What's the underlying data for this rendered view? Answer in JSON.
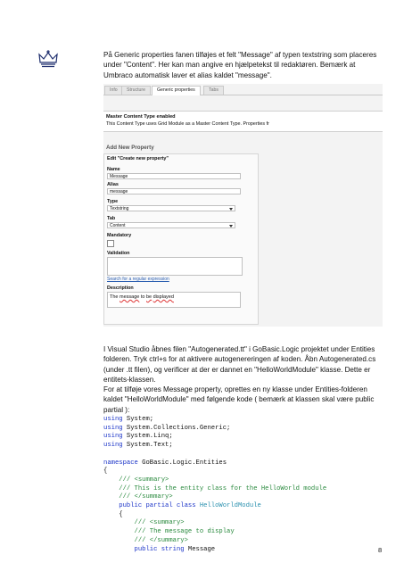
{
  "paragraph1": [
    "På Generic properties fanen tilføjes et felt \"Message\" af typen textstring som placeres",
    "under \"Content\". Her kan man angive en hjælpetekst til redaktøren. Bemærk at",
    "Umbraco automatisk laver et alias kaldet \"message\"."
  ],
  "screenshot": {
    "tabs": [
      "Info",
      "Structure",
      "Generic properties",
      "Tabs"
    ],
    "master_title": "Master Content Type enabled",
    "master_text": "This Content Type uses Grid Module as a Master Content Type. Properties fr",
    "add_new_property": "Add New Property",
    "edit_header": "Edit \"Create new property\"",
    "name_label": "Name",
    "name_value": "Message",
    "alias_label": "Alias",
    "alias_value": "message",
    "type_label": "Type",
    "type_value": "Textstring",
    "tab_label": "Tab",
    "tab_value": "Content",
    "mandatory_label": "Mandatory",
    "validation_label": "Validation",
    "regex_link": "Search for a regular expression",
    "description_label": "Description",
    "description_value": [
      "The ",
      "message",
      " to ",
      "be",
      " ",
      "displayed"
    ]
  },
  "paragraph2": [
    "I Visual Studio åbnes filen \"Autogenerated.tt\" i GoBasic.Logic projektet under Entities",
    "folderen. Tryk ctrl+s for at aktivere autogenereringen af koden. Åbn Autogenerated.cs",
    "(under .tt filen), og verificer at der er dannet en \"HelloWorldModule\" klasse. Dette er",
    "entitets-klassen.",
    "For at tilføje vores Message property, oprettes en ny klasse under Entities-folderen",
    "kaldet \"HelloWorldModule\" med følgende kode ( bemærk at klassen skal være public",
    "partial ):"
  ],
  "code": {
    "using_kw": "using",
    "usings": [
      "System;",
      "System.Collections.Generic;",
      "System.Linq;",
      "System.Text;"
    ],
    "namespace_kw": "namespace",
    "namespace_name": "GoBasic.Logic.Entities",
    "open_brace": "{",
    "summary_open": "/// <summary>",
    "class_comment": "/// This is the entity class for the HelloWorld module",
    "summary_close": "/// </summary>",
    "class_kw": "public partial class",
    "class_name": "HelloWorldModule",
    "member_comment": "/// The message to display",
    "member_kw": "public string",
    "member_name": "Message"
  },
  "page_number": "8"
}
